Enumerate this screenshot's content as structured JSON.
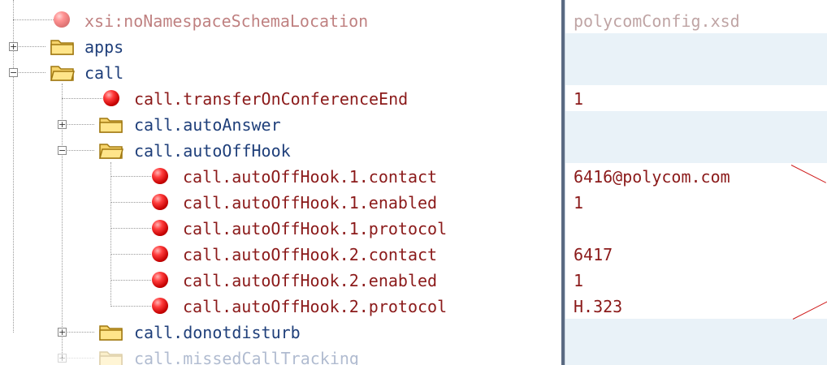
{
  "tree": {
    "rows": [
      {
        "label": "xsi:noNamespaceSchemaLocation",
        "kind": "attribute"
      },
      {
        "label": "apps",
        "kind": "folder",
        "toggle": "+"
      },
      {
        "label": "call",
        "kind": "folder",
        "toggle": "−"
      },
      {
        "label": "call.transferOnConferenceEnd",
        "kind": "attribute"
      },
      {
        "label": "call.autoAnswer",
        "kind": "folder",
        "toggle": "+"
      },
      {
        "label": "call.autoOffHook",
        "kind": "folder",
        "toggle": "−"
      },
      {
        "label": "call.autoOffHook.1.contact",
        "kind": "attribute"
      },
      {
        "label": "call.autoOffHook.1.enabled",
        "kind": "attribute"
      },
      {
        "label": "call.autoOffHook.1.protocol",
        "kind": "attribute"
      },
      {
        "label": "call.autoOffHook.2.contact",
        "kind": "attribute"
      },
      {
        "label": "call.autoOffHook.2.enabled",
        "kind": "attribute"
      },
      {
        "label": "call.autoOffHook.2.protocol",
        "kind": "attribute"
      },
      {
        "label": "call.donotdisturb",
        "kind": "folder",
        "toggle": "+"
      },
      {
        "label": "call.missedCallTracking",
        "kind": "folder",
        "toggle": "+"
      }
    ]
  },
  "values": [
    "polycomConfig.xsd",
    "",
    "",
    "1",
    "",
    "",
    "6416@polycom.com",
    "1",
    "",
    "6417",
    "1",
    "H.323",
    "",
    ""
  ],
  "colors": {
    "attribute_text": "#8b1a1a",
    "folder_text": "#1f3f7a",
    "value_row_tint": "#e9f2f8",
    "annotation_line": "#d02020"
  },
  "icons": {
    "attribute": "red-bullet-icon",
    "folder": "folder-icon",
    "expand": "expand-plus-icon",
    "collapse": "collapse-minus-icon"
  }
}
